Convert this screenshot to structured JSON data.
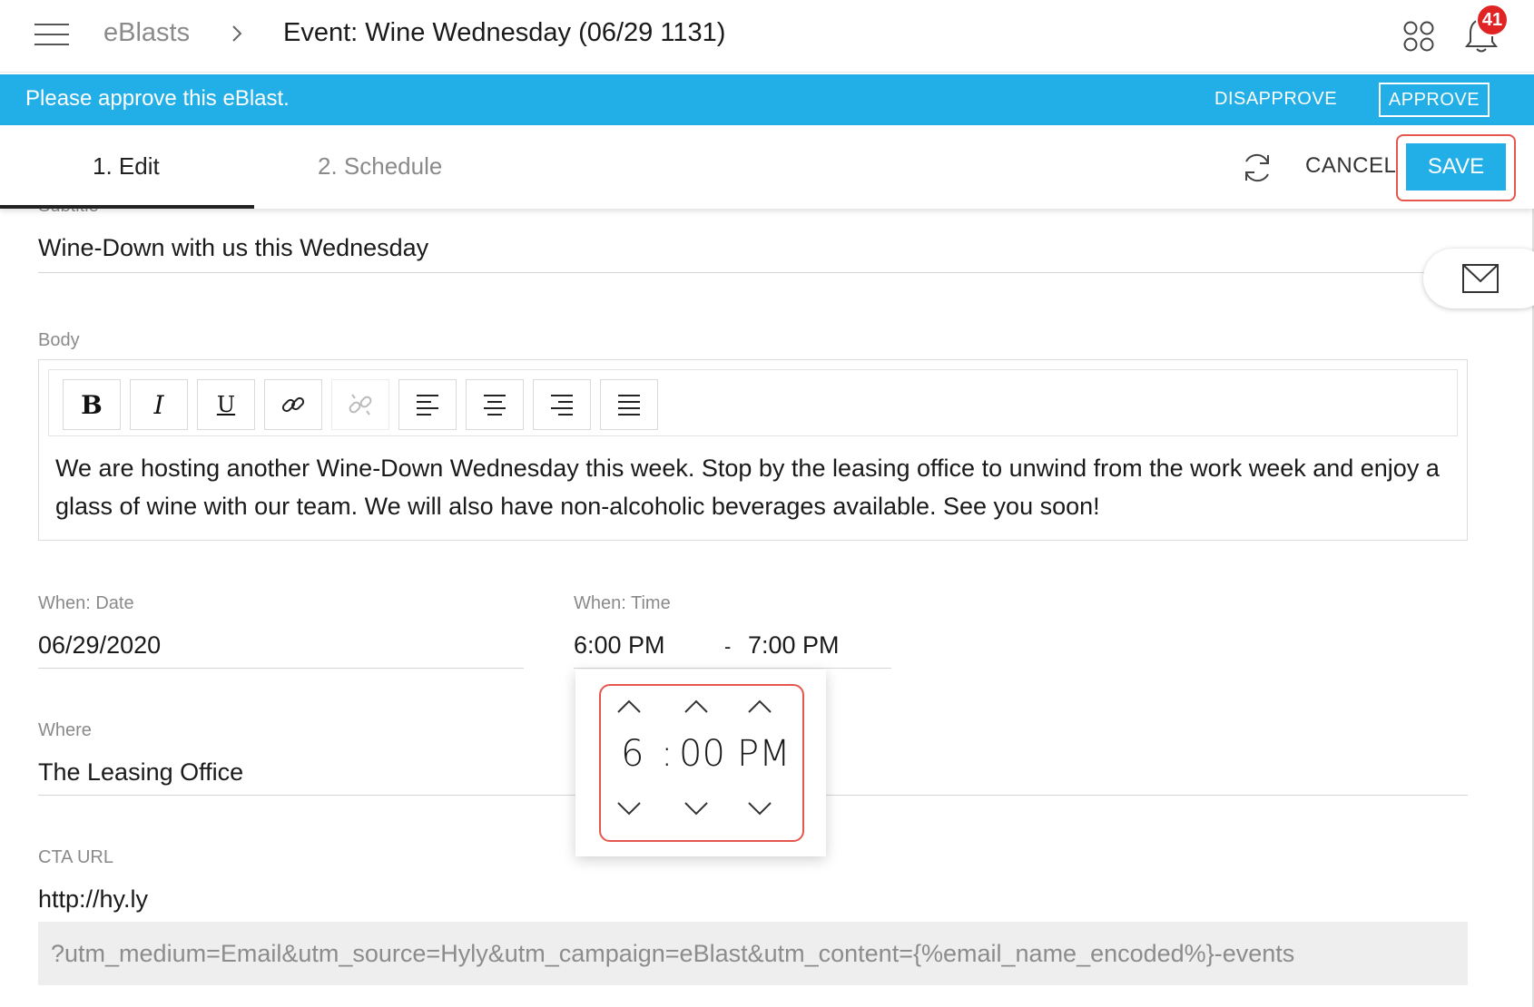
{
  "header": {
    "breadcrumb_root": "eBlasts",
    "breadcrumb_current": "Event: Wine Wednesday (06/29 1131)",
    "notification_count": "41"
  },
  "banner": {
    "message": "Please approve this eBlast.",
    "disapprove_label": "DISAPPROVE",
    "approve_label": "APPROVE",
    "background_color": "#22aee6"
  },
  "tabs": [
    {
      "label": "1. Edit",
      "active": true
    },
    {
      "label": "2. Schedule",
      "active": false
    }
  ],
  "actions": {
    "cancel_label": "CANCEL",
    "save_label": "SAVE"
  },
  "form": {
    "subtitle": {
      "label": "Subtitle",
      "value": "Wine-Down with us this Wednesday"
    },
    "body": {
      "label": "Body",
      "toolbar": [
        "bold-icon",
        "italic-icon",
        "underline-icon",
        "link-icon",
        "unlink-icon",
        "align-left-icon",
        "align-center-icon",
        "align-right-icon",
        "align-justify-icon"
      ],
      "bold_glyph": "B",
      "italic_glyph": "I",
      "underline_glyph": "U",
      "text": "We are hosting another Wine-Down Wednesday this week. Stop by the leasing office to unwind from the work week and enjoy a glass of wine with our team. We will also have non-alcoholic beverages available. See you soon!"
    },
    "when_date": {
      "label": "When: Date",
      "value": "06/29/2020"
    },
    "when_time": {
      "label": "When: Time",
      "start": "6:00 PM",
      "separator": "-",
      "end": "7:00 PM"
    },
    "where": {
      "label": "Where",
      "value": "The Leasing Office"
    },
    "cta_url": {
      "label": "CTA URL",
      "value": "http://hy.ly",
      "suffix": "?utm_medium=Email&utm_source=Hyly&utm_campaign=eBlast&utm_content={%email_name_encoded%}-events"
    }
  },
  "time_picker": {
    "hour": "6",
    "separator": ":",
    "minute": "00",
    "meridiem": "PM"
  },
  "colors": {
    "accent": "#22aee6",
    "highlight_outline": "#e5564c",
    "badge": "#e02424"
  }
}
